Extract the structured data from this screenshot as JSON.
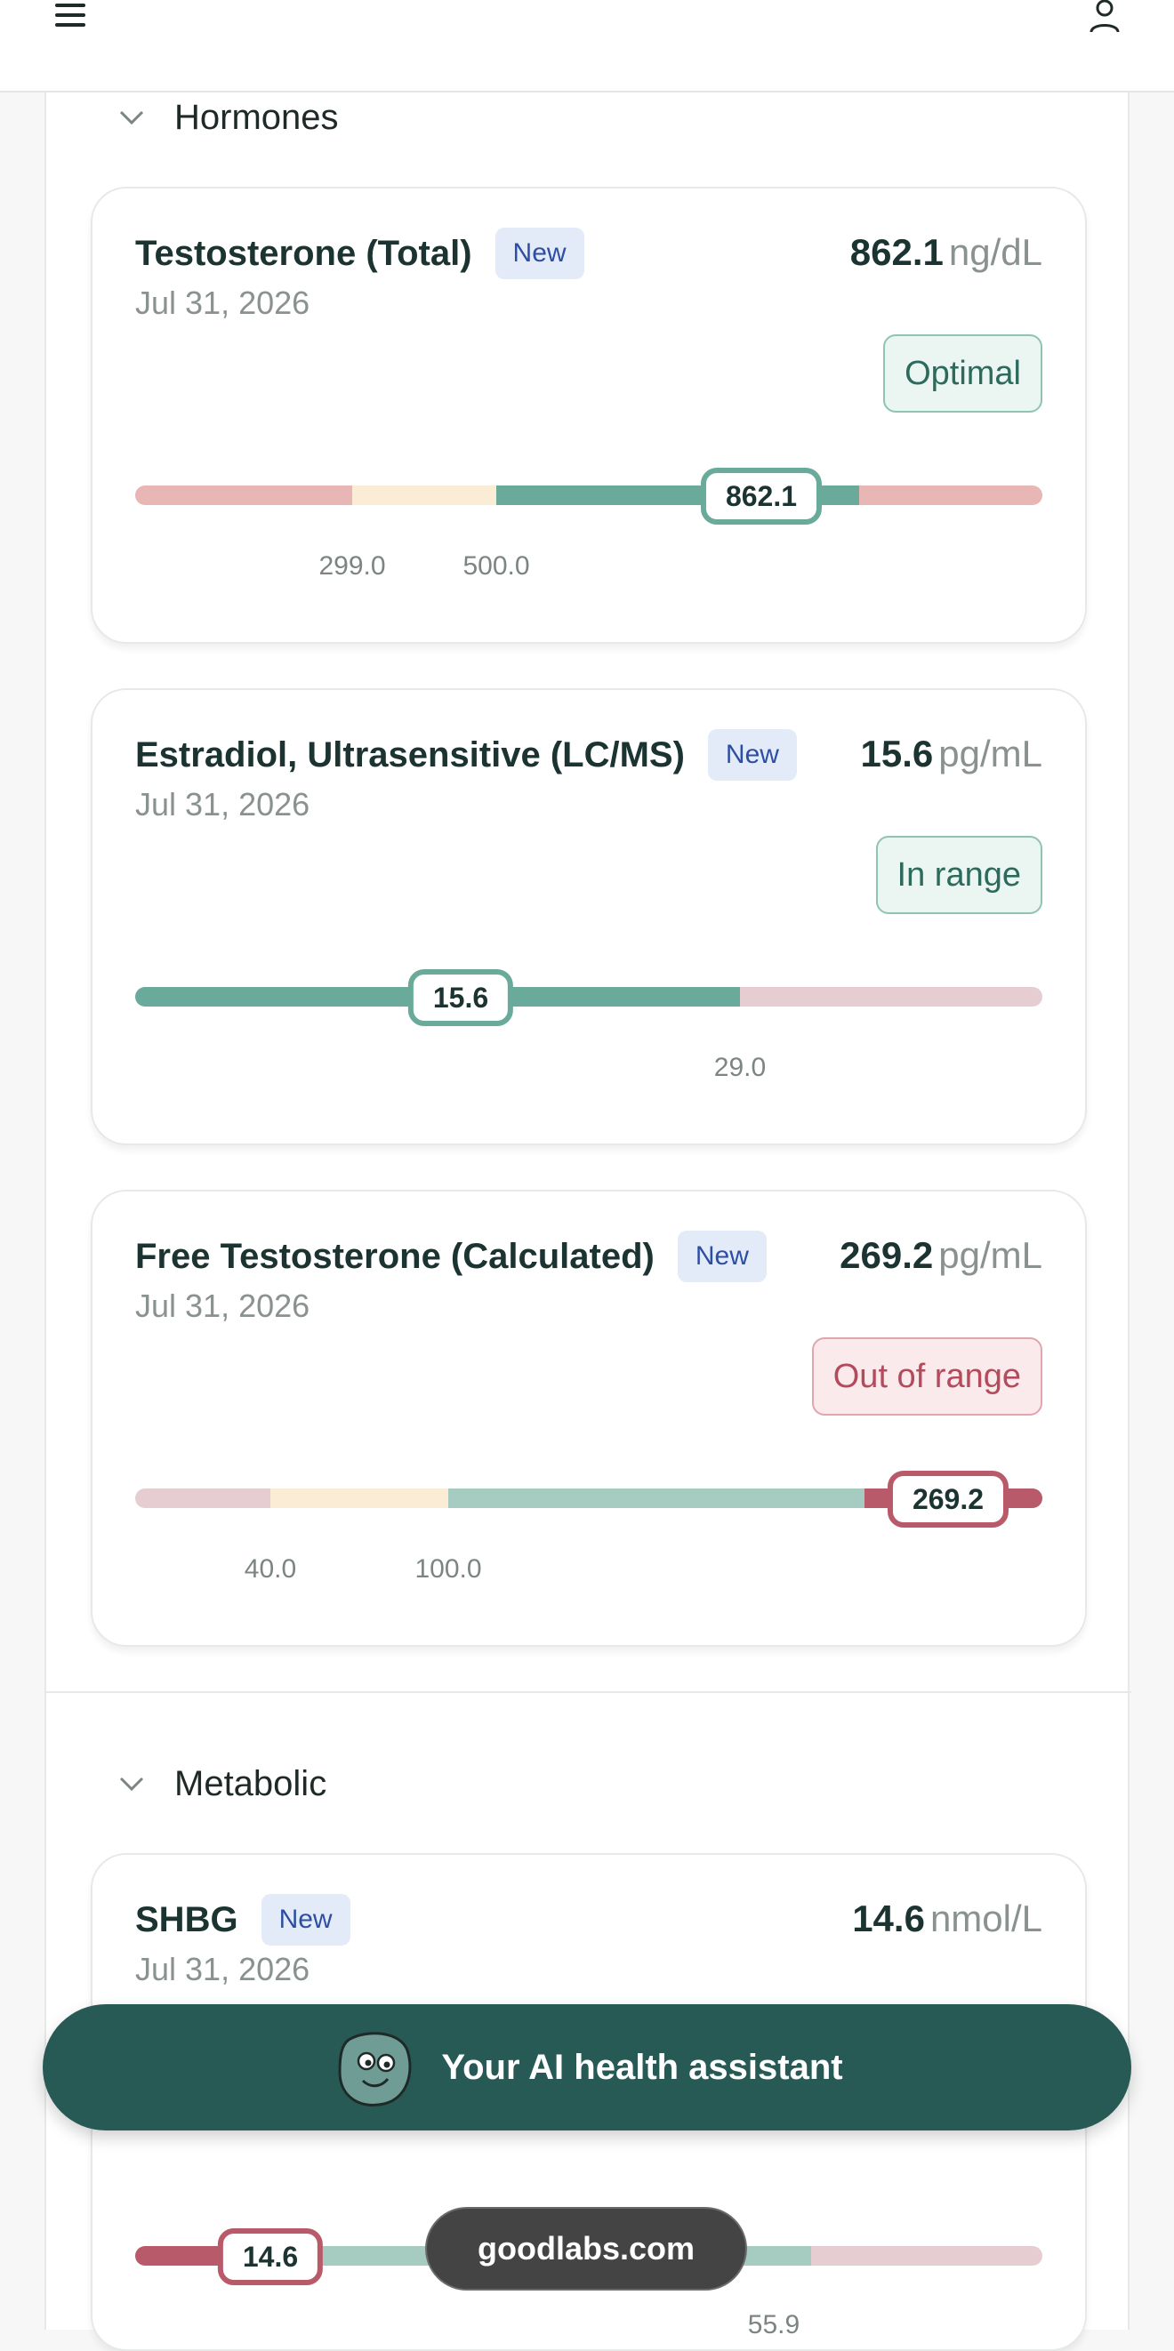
{
  "sections": {
    "hormones": "Hormones",
    "metabolic": "Metabolic"
  },
  "cards": [
    {
      "name": "Testosterone (Total)",
      "badge": "New",
      "date": "Jul 31, 2026",
      "value": "862.1",
      "unit": "ng/dL",
      "status": "Optimal",
      "marker": "862.1",
      "ticks": [
        "299.0",
        "500.0"
      ],
      "status_kind": "optimal"
    },
    {
      "name": "Estradiol, Ultrasensitive (LC/MS)",
      "badge": "New",
      "date": "Jul 31, 2026",
      "value": "15.6",
      "unit": "pg/mL",
      "status": "In range",
      "marker": "15.6",
      "ticks": [
        "29.0"
      ],
      "status_kind": "in-range"
    },
    {
      "name": "Free Testosterone (Calculated)",
      "badge": "New",
      "date": "Jul 31, 2026",
      "value": "269.2",
      "unit": "pg/mL",
      "status": "Out of range",
      "marker": "269.2",
      "ticks": [
        "40.0",
        "100.0"
      ],
      "status_kind": "out-of-range"
    },
    {
      "name": "SHBG",
      "badge": "New",
      "date": "Jul 31, 2026",
      "value": "14.6",
      "unit": "nmol/L",
      "marker": "14.6",
      "ticks": [
        "55.9"
      ]
    }
  ],
  "assistant": {
    "label": "Your AI health assistant"
  },
  "domain": "goodlabs.com",
  "colors": {
    "optimal": "#6aaa9a",
    "in_range_light": "#a6ccc2",
    "borderline": "#fbecd5",
    "out_of_range": "#e9b6b6",
    "out_of_range_strong": "#b85a69",
    "low_pink": "#e6cdd1"
  }
}
